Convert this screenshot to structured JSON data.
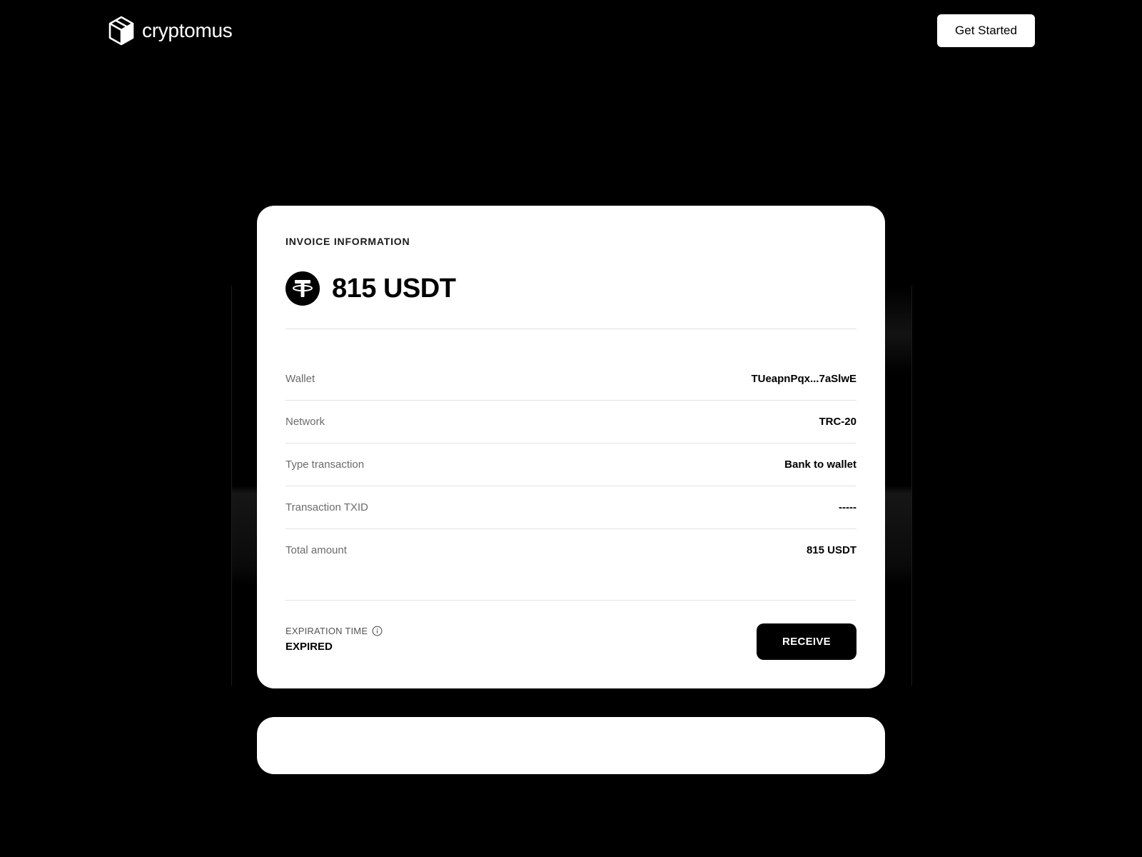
{
  "header": {
    "logo_text": "cryptomus",
    "cta_label": "Get Started"
  },
  "invoice": {
    "section_title": "INVOICE INFORMATION",
    "amount": "815 USDT",
    "coin_icon": "tether-icon",
    "rows": [
      {
        "label": "Wallet",
        "value": "TUeapnPqx...7aSlwE"
      },
      {
        "label": "Network",
        "value": "TRC-20"
      },
      {
        "label": "Type transaction",
        "value": "Bank to wallet"
      },
      {
        "label": "Transaction TXID",
        "value": "-----"
      },
      {
        "label": "Total amount",
        "value": "815 USDT"
      }
    ],
    "expiration_label": "EXPIRATION TIME",
    "expiration_value": "EXPIRED",
    "receive_label": "RECEIVE"
  },
  "colors": {
    "background": "#000000",
    "card": "#ffffff",
    "accent": "#000000"
  }
}
